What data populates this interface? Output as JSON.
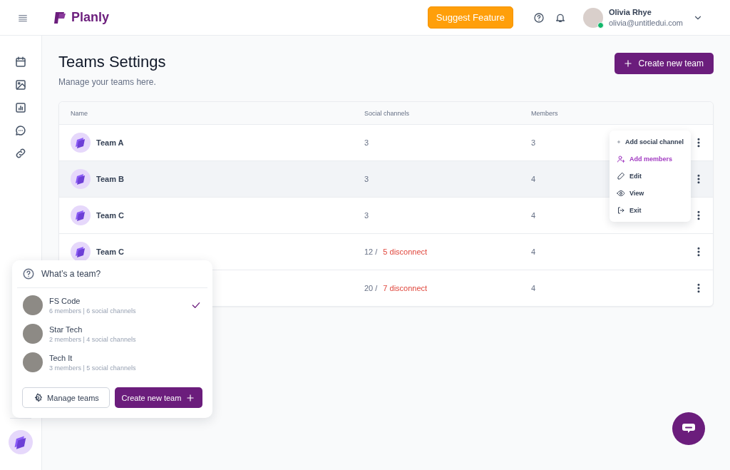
{
  "topbar": {
    "brand": "Planly",
    "suggest_button": "Suggest Feature",
    "user": {
      "name": "Olivia Rhye",
      "email": "olivia@untitledui.com",
      "online": true
    }
  },
  "page": {
    "title": "Teams Settings",
    "subtitle": "Manage your teams here.",
    "create_button": "Create new team"
  },
  "table": {
    "columns": [
      "Name",
      "Social channels",
      "Members"
    ],
    "rows": [
      {
        "name": "Team A",
        "social": "3",
        "members": "3",
        "selected": false
      },
      {
        "name": "Team B",
        "social": "3",
        "members": "4",
        "selected": true
      },
      {
        "name": "Team C",
        "social": "3",
        "members": "4",
        "selected": false
      },
      {
        "name": "Team C",
        "social": "12 /",
        "disconnect": "5 disconnect",
        "members": "4",
        "selected": false
      },
      {
        "social": "20 /",
        "disconnect": "7 disconnect",
        "members": "4",
        "selected": false
      }
    ]
  },
  "row_menu": {
    "items": [
      {
        "kind": "add",
        "label": "Add social channel",
        "selected": false
      },
      {
        "kind": "user",
        "label": "Add members",
        "selected": true
      },
      {
        "kind": "edit",
        "label": "Edit",
        "selected": false
      },
      {
        "kind": "view",
        "label": "View",
        "selected": false
      },
      {
        "kind": "exit",
        "label": "Exit",
        "selected": false
      }
    ]
  },
  "team_popover": {
    "title": "What’s a team?",
    "teams": [
      {
        "name": "FS Code",
        "details": "6 members | 6 social channels",
        "selected": true
      },
      {
        "name": "Star Tech",
        "details": "2 members | 4 social channels",
        "selected": false
      },
      {
        "name": "Tech It",
        "details": "3 members | 5 social channels",
        "selected": false
      }
    ],
    "manage_button": "Manage teams",
    "create_button": "Create new team"
  }
}
